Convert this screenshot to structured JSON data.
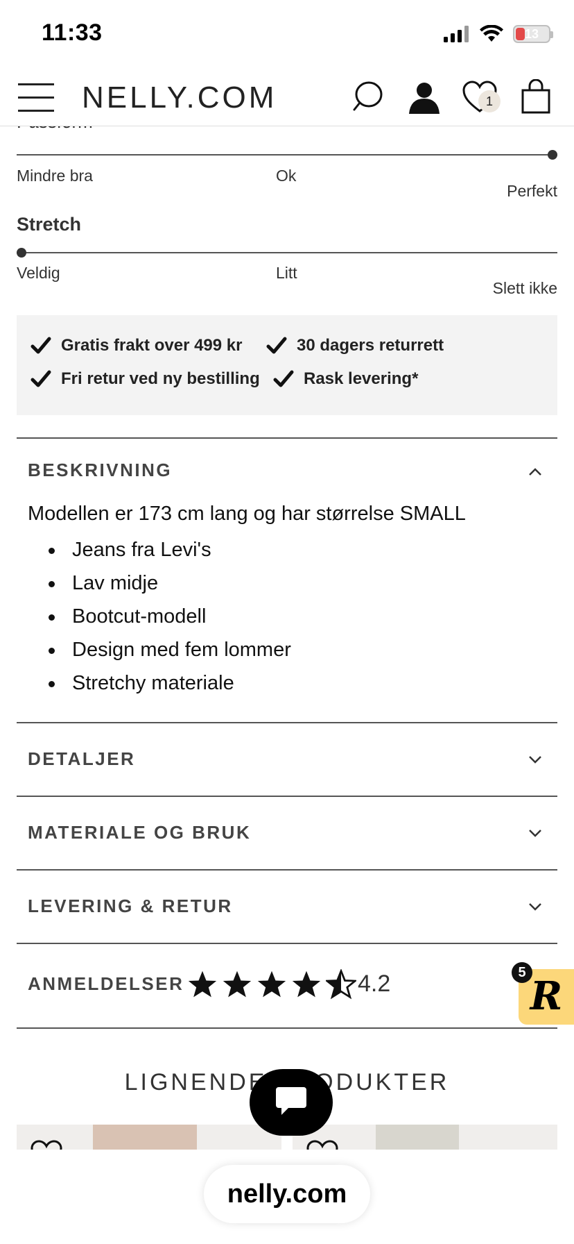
{
  "status_bar": {
    "time": "11:33",
    "battery": "13"
  },
  "header": {
    "logo": "NELLY.COM",
    "wishlist_count": "1"
  },
  "fit": {
    "passform_title": "Passform",
    "passform_level": 1.0,
    "passform_labels": {
      "low": "Mindre bra",
      "mid": "Ok",
      "high": "Perfekt"
    },
    "stretch_title": "Stretch",
    "stretch_level": 0.0,
    "stretch_labels": {
      "low": "Veldig",
      "mid": "Litt",
      "high": "Slett ikke"
    }
  },
  "usps": [
    "Gratis frakt over 499 kr",
    "30 dagers returrett",
    "Fri retur ved ny bestilling",
    "Rask levering*"
  ],
  "accordion": {
    "description": {
      "title": "BESKRIVNING",
      "intro": "Modellen er 173 cm lang og har størrelse SMALL",
      "bullets": [
        "Jeans fra Levi's",
        "Lav midje",
        "Bootcut-modell",
        "Design med fem lommer",
        "Stretchy materiale"
      ]
    },
    "details_title": "DETALJER",
    "material_title": "MATERIALE OG BRUK",
    "delivery_title": "LEVERING & RETUR"
  },
  "reviews": {
    "title": "ANMELDELSER",
    "rating": "4.2",
    "rating_value": 4.2,
    "max": 5
  },
  "similar": {
    "title": "LIGNENDE PRODUKTER"
  },
  "reviews_badge": {
    "count": "5",
    "letter": "R"
  },
  "browser": {
    "url": "nelly.com"
  },
  "colors": {
    "text": "#222222",
    "usp_bg": "#f3f3f3",
    "badge": "#fcd77a"
  }
}
